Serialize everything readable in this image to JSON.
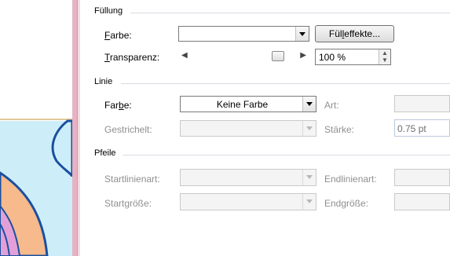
{
  "fill_group": {
    "title": "Füllung",
    "color_label": "Farbe:",
    "color_value": "",
    "effects_button": "Fülleffekte...",
    "transparency_label": "Transparenz:",
    "transparency_value": "100 %",
    "transparency_level": 1.0
  },
  "line_group": {
    "title": "Linie",
    "color_label": "Farbe:",
    "color_value": "Keine Farbe",
    "dashed_label": "Gestrichelt:",
    "style_label": "Art:",
    "weight_label": "Stärke:",
    "weight_value": "0.75 pt"
  },
  "arrows_group": {
    "title": "Pfeile",
    "start_style_label": "Startlinienart:",
    "end_style_label": "Endlinienart:",
    "start_size_label": "Startgröße:",
    "end_size_label": "Endgröße:"
  },
  "colors": {
    "canvas_fill": "#cdeef8",
    "shape_orange": "#f7ba8c",
    "shape_outline": "#1a4fa0",
    "shape_pink": "#e3a0d8",
    "accent_pink": "#e7b3c4"
  }
}
